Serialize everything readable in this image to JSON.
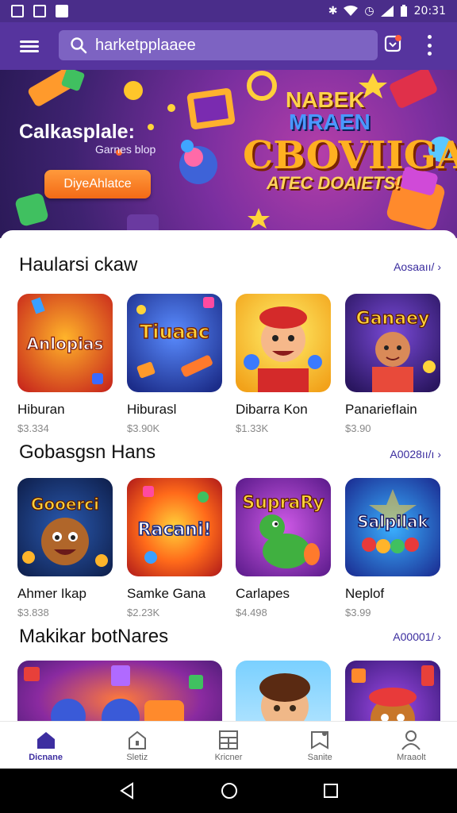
{
  "status_bar": {
    "time": "20:31"
  },
  "search": {
    "value": "harketpplaaee"
  },
  "banner": {
    "title": "Calkasplale:",
    "subtitle": "Garnes blop",
    "cta_label": "DiyeAhlatce",
    "logo_line1": "NABEK",
    "logo_line2": "MRAEN",
    "logo_big": "CBOVIIGAS",
    "logo_small": "ATEC DOAIETS!"
  },
  "sections": [
    {
      "title": "Haularsi ckaw",
      "link": "Aosaaıı/ ›",
      "games": [
        {
          "art_text": "Anlopias",
          "name": "Hiburan",
          "price": "$3.334",
          "icon": "game-tile-red-logo"
        },
        {
          "art_text": "Tiuaac",
          "name": "Hiburasl",
          "price": "$3.90K",
          "icon": "game-tile-candy-blue"
        },
        {
          "art_text": "",
          "name": "Dibarra Kon",
          "price": "$1.33K",
          "icon": "game-tile-cartoon-boy"
        },
        {
          "art_text": "Ganaey",
          "name": "PanariefIain",
          "price": "$3.90",
          "icon": "game-tile-kid-purple"
        }
      ]
    },
    {
      "title": "Gobasgsn Hans",
      "link": "A0028ıı/ı ›",
      "games": [
        {
          "art_text": "Gooerci",
          "name": "Ahmer Ikap",
          "price": "$3.838",
          "icon": "game-tile-cookie"
        },
        {
          "art_text": "Racani!",
          "name": "Samke Gana",
          "price": "$2.23K",
          "icon": "game-tile-racani"
        },
        {
          "art_text": "SupraRy",
          "name": "Carlapes",
          "price": "$4.498",
          "icon": "game-tile-dino"
        },
        {
          "art_text": "Salpilak",
          "name": "Neplof",
          "price": "$3.99",
          "icon": "game-tile-candy-pop"
        }
      ]
    },
    {
      "title": "Makikar botNares",
      "link": "A00001/ ›",
      "games": []
    }
  ],
  "bottom_nav": [
    {
      "label": "Dicnane",
      "icon": "home-icon",
      "active": true
    },
    {
      "label": "Sletiz",
      "icon": "store-icon",
      "active": false
    },
    {
      "label": "Kricner",
      "icon": "grid-icon",
      "active": false
    },
    {
      "label": "Sanite",
      "icon": "bookmark-icon",
      "active": false
    },
    {
      "label": "Mraaolt",
      "icon": "profile-icon",
      "active": false
    }
  ],
  "colors": {
    "app_bar": "#56349e",
    "accent": "#3d2ea0",
    "cta": "#f36a16"
  }
}
